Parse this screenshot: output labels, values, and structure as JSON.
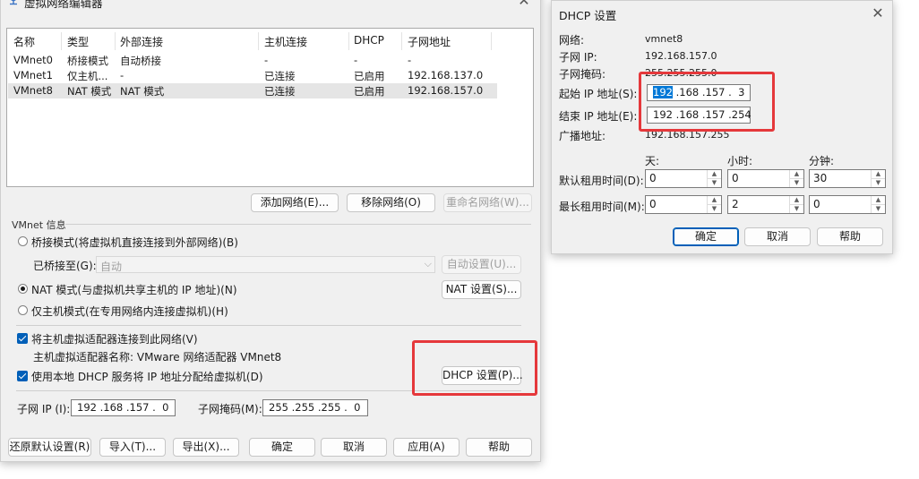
{
  "main": {
    "title": "虚拟网络编辑器",
    "table": {
      "headers": [
        "名称",
        "类型",
        "外部连接",
        "主机连接",
        "DHCP",
        "子网地址"
      ],
      "rows": [
        [
          "VMnet0",
          "桥接模式",
          "自动桥接",
          "-",
          "-",
          "-"
        ],
        [
          "VMnet1",
          "仅主机...",
          "-",
          "已连接",
          "已启用",
          "192.168.137.0"
        ],
        [
          "VMnet8",
          "NAT 模式",
          "NAT 模式",
          "已连接",
          "已启用",
          "192.168.157.0"
        ]
      ]
    },
    "buttons": {
      "add": "添加网络(E)...",
      "remove": "移除网络(O)",
      "rename": "重命名网络(W)...",
      "auto_settings": "自动设置(U)...",
      "nat_settings": "NAT 设置(S)...",
      "dhcp_settings": "DHCP 设置(P)...",
      "restore": "还原默认设置(R)",
      "import": "导入(T)...",
      "export": "导出(X)...",
      "ok": "确定",
      "cancel": "取消",
      "apply": "应用(A)",
      "help": "帮助"
    },
    "vmnet_info": {
      "group_label": "VMnet 信息",
      "bridged_radio": "桥接模式(将虚拟机直接连接到外部网络)(B)",
      "bridged_to_label": "已桥接至(G):",
      "bridged_to_value": "自动",
      "nat_radio": "NAT 模式(与虚拟机共享主机的 IP 地址)(N)",
      "host_only_radio": "仅主机模式(在专用网络内连接虚拟机)(H)",
      "connect_adapter_check": "将主机虚拟适配器连接到此网络(V)",
      "adapter_name_label": "主机虚拟适配器名称: VMware 网络适配器 VMnet8",
      "use_dhcp_check": "使用本地 DHCP 服务将 IP 地址分配给虚拟机(D)",
      "subnet_ip_label": "子网 IP (I):",
      "subnet_ip_value": "192 .168 .157 .  0",
      "subnet_mask_label": "子网掩码(M):",
      "subnet_mask_value": "255 .255 .255 .  0",
      "selected_mode": "nat"
    }
  },
  "dhcp": {
    "title": "DHCP 设置",
    "network_label": "网络:",
    "network_value": "vmnet8",
    "subnet_ip_label": "子网 IP:",
    "subnet_ip_value": "192.168.157.0",
    "subnet_mask_label": "子网掩码:",
    "subnet_mask_value": "255.255.255.0",
    "start_ip_label": "起始 IP 地址(S):",
    "start_ip_selected": "192",
    "start_ip_rest": " .168 .157 .  3",
    "end_ip_label": "结束 IP 地址(E):",
    "end_ip_value": "192 .168 .157 .254",
    "broadcast_label": "广播地址:",
    "broadcast_value": "192.168.157.255",
    "col_day": "天:",
    "col_hour": "小时:",
    "col_minute": "分钟:",
    "default_lease_label": "默认租用时间(D):",
    "default_lease": [
      "0",
      "0",
      "30"
    ],
    "max_lease_label": "最长租用时间(M):",
    "max_lease": [
      "0",
      "2",
      "0"
    ],
    "ok": "确定",
    "cancel": "取消",
    "help": "帮助"
  },
  "colors": {
    "highlight_box": "#e5383b",
    "accent": "#005fb8"
  }
}
